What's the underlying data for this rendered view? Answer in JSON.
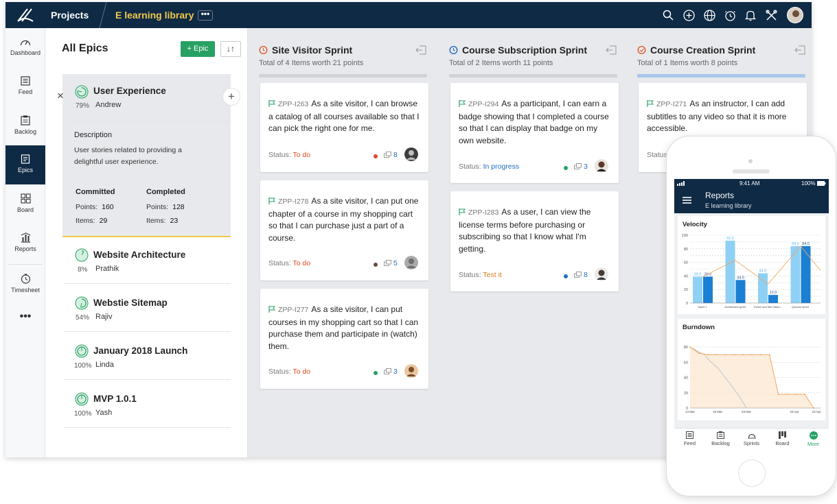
{
  "topbar": {
    "projects_label": "Projects",
    "project_name": "E learning library",
    "more_label": "•••",
    "icons": [
      "search-icon",
      "add-circle-icon",
      "globe-icon",
      "timer-icon",
      "bell-icon",
      "tools-icon"
    ]
  },
  "nav": {
    "items": [
      {
        "label": "Dashboard",
        "icon": "dashboard-icon"
      },
      {
        "label": "Feed",
        "icon": "feed-icon"
      },
      {
        "label": "Backlog",
        "icon": "backlog-icon"
      },
      {
        "label": "Epics",
        "icon": "epics-icon",
        "active": true
      },
      {
        "label": "Board",
        "icon": "board-icon"
      },
      {
        "label": "Reports",
        "icon": "reports-icon"
      },
      {
        "label": "Timesheet",
        "icon": "timesheet-icon"
      }
    ],
    "more_label": "•••"
  },
  "epics": {
    "title": "All Epics",
    "add_label": "+ Epic",
    "sort_label": "↓↑",
    "selected": {
      "name": "User Experience",
      "percent": "79%",
      "owner": "Andrew",
      "progress": 0.79,
      "description_heading": "Description",
      "description": "User stories related to providing a delightful user experience.",
      "committed_heading": "Committed",
      "completed_heading": "Completed",
      "points_label": "Points:",
      "items_label": "Items:",
      "committed_points": "160",
      "committed_items": "29",
      "completed_points": "128",
      "completed_items": "23"
    },
    "list": [
      {
        "name": "Website Architecture",
        "percent": "8%",
        "owner": "Prathik",
        "progress": 0.08
      },
      {
        "name": "Webstie Sitemap",
        "percent": "54%",
        "owner": "Rajiv",
        "progress": 0.54
      },
      {
        "name": "January 2018 Launch",
        "percent": "100%",
        "owner": "Linda",
        "progress": 1.0
      },
      {
        "name": "MVP 1.0.1",
        "percent": "100%",
        "owner": "Yash",
        "progress": 1.0
      }
    ]
  },
  "board": {
    "columns": [
      {
        "title": "Site Visitor Sprint",
        "subtitle": "Total of 4 Items worth 21 points",
        "icon_color": "#e05a2b",
        "cards": [
          {
            "id": "ZPP-I263",
            "text": "As a site visitor, I can browse a catalog of all courses available so that I can pick the right one for me.",
            "status_label": "Status:",
            "status": "To do",
            "points": "8",
            "dot_color": "#e0452b"
          },
          {
            "id": "ZPP-I278",
            "text": "As a site visitor, I can put one chapter of a course in my shopping cart so that I can purchase just a part of a course.",
            "status_label": "Status:",
            "status": "To do",
            "points": "5",
            "dot_color": "#6b4a3a"
          },
          {
            "id": "ZPP-I277",
            "text": "As a site visitor, I can put courses in my shopping cart so that I can purchase them and participate in (watch) them.",
            "status_label": "Status:",
            "status": "To do",
            "points": "3",
            "dot_color": "#27a163"
          }
        ]
      },
      {
        "title": "Course Subscription Sprint",
        "subtitle": "Total of 2 Items worth 11 points",
        "icon_color": "#1f6dc2",
        "cards": [
          {
            "id": "ZPP-I294",
            "text": "As a participant, I can earn a badge showing that I completed a course so that I can display that badge on my own website.",
            "status_label": "Status:",
            "status": "In progress",
            "points": "3",
            "dot_color": "#27a163"
          },
          {
            "id": "ZPP-I283",
            "text": "As a user, I can view the license terms before purchasing or subscribing so that I know what I'm getting.",
            "status_label": "Status:",
            "status": "Test it",
            "points": "8",
            "dot_color": "#1f6dc2"
          }
        ]
      },
      {
        "title": "Course Creation Sprint",
        "subtitle": "Total of 1 Items worth 8 points",
        "icon_color": "#e05a2b",
        "cards": [
          {
            "id": "ZPP-I271",
            "text": "As an instructor, I can add subtitles to any video so that it is more accessible.",
            "status_label": "Status",
            "status": "",
            "points": "",
            "dot_color": ""
          }
        ]
      }
    ]
  },
  "phone": {
    "status_time": "9:41 AM",
    "battery": "100%",
    "title": "Reports",
    "subtitle": "E learning library",
    "velocity_title": "Velocity",
    "burndown_title": "Burndown",
    "tabs": [
      {
        "label": "Feed",
        "icon": "feed-icon"
      },
      {
        "label": "Backlog",
        "icon": "backlog-icon"
      },
      {
        "label": "Sprints",
        "icon": "sprints-icon"
      },
      {
        "label": "Board",
        "icon": "board-icon"
      },
      {
        "label": "More",
        "icon": "more-icon",
        "active": true
      }
    ]
  },
  "chart_data": [
    {
      "type": "bar",
      "title": "Velocity",
      "categories": [
        "Sprint 1",
        "Architecture sprint",
        "Trainer and Site Visitor...",
        "Quizzes Sprint"
      ],
      "series": [
        {
          "values": [
            39.0,
            92.0,
            44.0,
            84.0
          ]
        },
        {
          "values": [
            39.0,
            34.0,
            12.0,
            84.0
          ]
        }
      ],
      "ylim": [
        0,
        100
      ],
      "yticks": [
        0,
        10,
        20,
        30,
        40,
        50,
        60,
        70,
        80,
        90,
        100
      ],
      "data_labels": [
        "39.0",
        "39.0",
        "92.0",
        "34.0",
        "44.0",
        "12.0",
        "84.0",
        "84.0"
      ],
      "grid": true,
      "colors": [
        "#8fd0f5",
        "#1b7fd4",
        "#f0a860"
      ]
    },
    {
      "type": "line",
      "title": "Burndown",
      "x_ticks": [
        "14 Mar",
        "18 Mar",
        "23 Mar",
        "",
        "23 Apr",
        "23 Apr"
      ],
      "yticks": [
        0,
        20,
        40,
        60,
        80
      ],
      "ylim": [
        0,
        90
      ],
      "series": [
        {
          "values": [
            80,
            72,
            70,
            70,
            70,
            70,
            70,
            70,
            70,
            70,
            18,
            18,
            18,
            18,
            0
          ]
        },
        {
          "values": [
            80,
            75,
            70,
            60,
            52,
            40,
            28,
            15,
            0
          ]
        }
      ],
      "grid": true,
      "colors": [
        "#f0a860",
        "#b8c2cc"
      ]
    }
  ]
}
